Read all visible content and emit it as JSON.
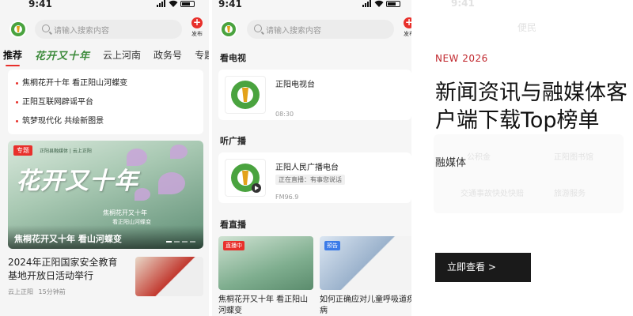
{
  "status_bar": {
    "time": "9:41"
  },
  "phone1": {
    "search_placeholder": "请输入搜索内容",
    "publish_label": "发布",
    "tabs": [
      {
        "label": "推荐",
        "active": true
      },
      {
        "label": "花开又十年",
        "active": false,
        "style": "brand-logo"
      },
      {
        "label": "云上河南",
        "active": false
      },
      {
        "label": "政务号",
        "active": false
      },
      {
        "label": "专题",
        "active": false
      }
    ],
    "headlines": [
      "焦桐花开十年 看正阳山河蝶变",
      "正阳互联网辟谣平台",
      "筑梦现代化 共绘新图景"
    ],
    "banner": {
      "tag": "专题",
      "partners": "正阳县融媒体 | 云上正阳",
      "art_title": "花开又十年",
      "art_line1": "焦桐花开又十年",
      "art_line2": "看正阳山河蝶变",
      "caption": "焦桐花开又十年 看山河蝶变"
    },
    "news": {
      "title": "2024年正阳国家安全教育基地开放日活动举行",
      "source": "云上正阳",
      "time": "15分钟前"
    }
  },
  "phone2": {
    "search_placeholder": "请输入搜索内容",
    "publish_label": "发布",
    "tv_section": "看电视",
    "tv_card": {
      "name": "正阳电视台",
      "time": "08:30"
    },
    "radio_section": "听广播",
    "radio_card": {
      "name": "正阳人民广播电台",
      "live": "正在直播：有事您说话",
      "freq": "FM96.9"
    },
    "live_section": "看直播",
    "videos": [
      {
        "badge": "直播中",
        "title": "焦桐花开又十年 看正阳山河蝶变"
      },
      {
        "badge": "预告",
        "title": "如何正确应对儿童呼吸道疾病"
      }
    ]
  },
  "phone3_faded": {
    "time": "9:41",
    "header": "便民",
    "items": [
      "公积金",
      "正阳图书馆",
      "交通事故快处快赔",
      "旅游服务"
    ]
  },
  "overlay": {
    "tag": "NEW 2026",
    "title": "新闻资讯与融媒体客\n户端下载Top榜单",
    "subtitle": "融媒体",
    "button": "立即查看 >"
  },
  "colors": {
    "accent_red": "#e8302b",
    "brand_green": "#3b8a3a",
    "button_dark": "#1a1a1a",
    "tag_red": "#c1272d"
  }
}
